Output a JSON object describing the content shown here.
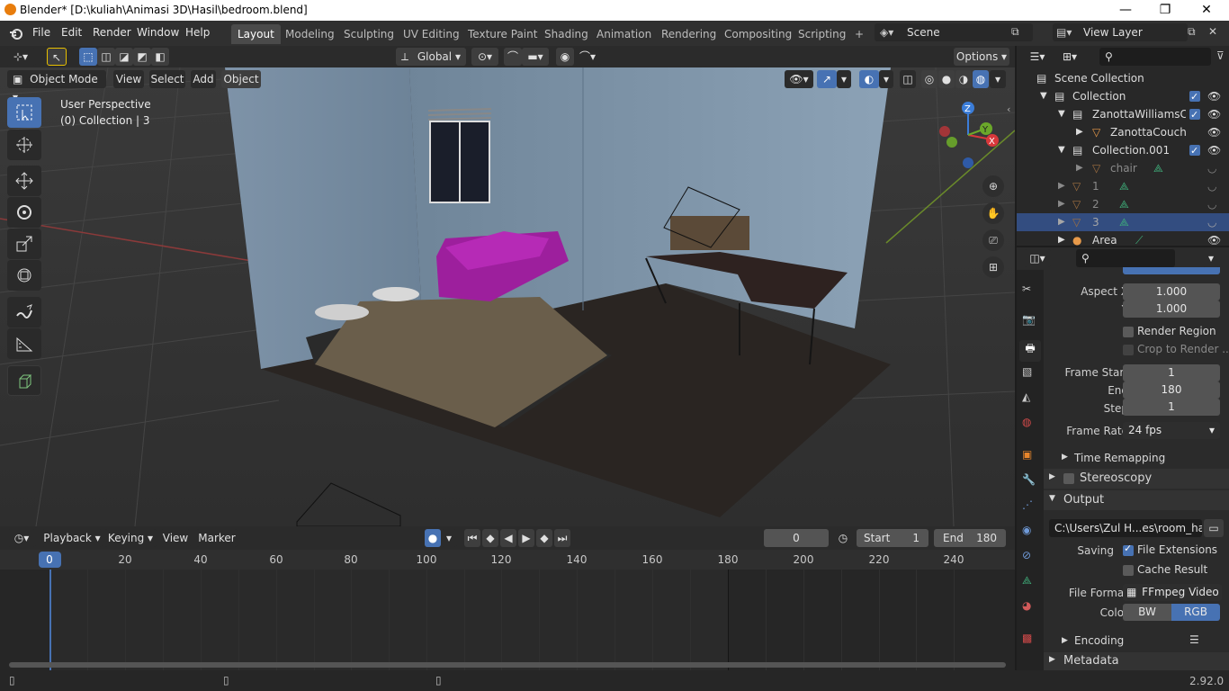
{
  "window": {
    "title": "Blender* [D:\\kuliah\\Animasi 3D\\Hasil\\bedroom.blend]",
    "min": "—",
    "max": "❐",
    "close": "✕"
  },
  "menu": [
    "File",
    "Edit",
    "Render",
    "Window",
    "Help"
  ],
  "workspaces": [
    "Layout",
    "Modeling",
    "Sculpting",
    "UV Editing",
    "Texture Paint",
    "Shading",
    "Animation",
    "Rendering",
    "Compositing",
    "Scripting",
    "+"
  ],
  "scene": "Scene",
  "view_layer": "View Layer",
  "viewport_header": {
    "orientation": "Global",
    "options": "Options",
    "mode": "Object Mode",
    "menus": [
      "View",
      "Select",
      "Add",
      "Object"
    ]
  },
  "viewport": {
    "info_line1": "User Perspective",
    "info_line2": "(0) Collection | 3",
    "gizmo": {
      "x": "X",
      "y": "Y",
      "z": "Z"
    }
  },
  "timeline": {
    "menus": [
      "Playback",
      "Keying",
      "View",
      "Marker"
    ],
    "current_frame": "0",
    "start_label": "Start",
    "start": "1",
    "end_label": "End",
    "end": "180",
    "ruler": [
      "0",
      "20",
      "40",
      "60",
      "80",
      "100",
      "120",
      "140",
      "160",
      "180",
      "200",
      "220",
      "240"
    ]
  },
  "outliner": {
    "rows": [
      {
        "label": "Scene Collection",
        "indent": 0
      },
      {
        "label": "Collection",
        "indent": 1
      },
      {
        "label": "ZanottaWilliamsCou",
        "indent": 2
      },
      {
        "label": "ZanottaCouch_B",
        "indent": 3
      },
      {
        "label": "Collection.001",
        "indent": 2
      },
      {
        "label": "chair",
        "indent": 3
      },
      {
        "label": "1",
        "indent": 2
      },
      {
        "label": "2",
        "indent": 2
      },
      {
        "label": "3",
        "indent": 2,
        "selected": true
      },
      {
        "label": "Area",
        "indent": 2
      }
    ]
  },
  "properties": {
    "aspect_x_label": "Aspect X",
    "aspect_x": "1.000",
    "aspect_y_label": "Y",
    "aspect_y": "1.000",
    "render_region": "Render Region",
    "crop_to_render": "Crop to Render ...",
    "frame_start_label": "Frame Start",
    "frame_start": "1",
    "end_label": "End",
    "end": "180",
    "step_label": "Step",
    "step": "1",
    "frame_rate_label": "Frame Rate",
    "frame_rate": "24 fps",
    "time_remapping": "Time Remapping",
    "stereoscopy": "Stereoscopy",
    "output": "Output",
    "output_path": "C:\\Users\\Zul H...es\\room_hamdi",
    "saving_label": "Saving",
    "file_extensions": "File Extensions",
    "cache_result": "Cache Result",
    "file_format_label": "File Format",
    "file_format": "FFmpeg Video",
    "color_label": "Color",
    "color_bw": "BW",
    "color_rgb": "RGB",
    "encoding": "Encoding",
    "metadata": "Metadata"
  },
  "status": {
    "version": "2.92.0"
  }
}
